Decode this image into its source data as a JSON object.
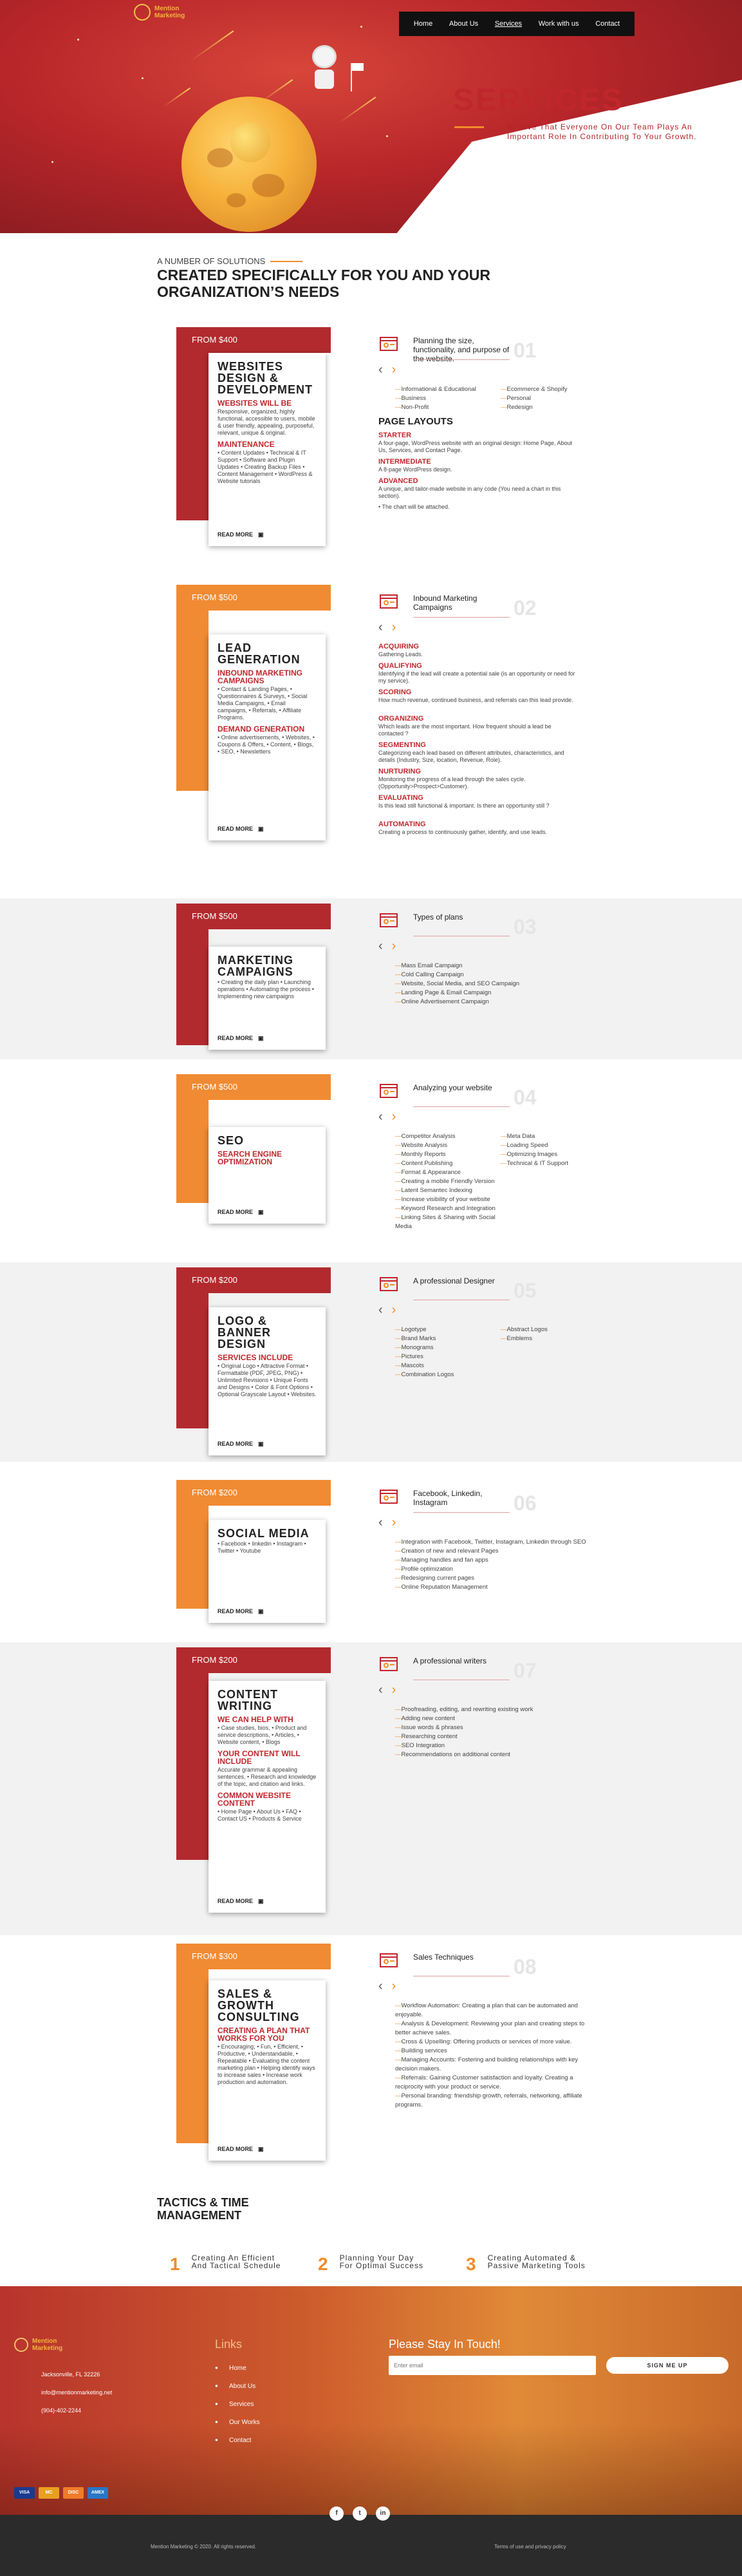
{
  "brand": {
    "name_line1": "Mention",
    "name_line2": "Marketing"
  },
  "nav": [
    "Home",
    "About Us",
    "Services",
    "Work with us",
    "Contact"
  ],
  "hero": {
    "title": "SERVICES",
    "subtitle": "Believe That Everyone On Our Team Plays An Important Role In Contributing To Your Growth."
  },
  "intro": {
    "small": "A NUMBER OF SOLUTIONS",
    "big": "CREATED SPECIFICALLY FOR YOU AND YOUR ORGANIZATION’S NEEDS"
  },
  "read_more": "READ MORE",
  "services": [
    {
      "price": "FROM $400",
      "block_color": "red",
      "title": "WEBSITES DESIGN & DEVELOPMENT",
      "subs": [
        {
          "h": "WEBSITES WILL BE",
          "p": "Responsive, organized, highly functional, accessible to users, mobile & user friendly, appealing, purposeful, relevant, unique & original."
        },
        {
          "h": "MAINTENANCE",
          "p": "• Content Updates • Technical & IT Support • Software and Plugin Updates • Creating Backup Files • Content Management • WordPress & Website tutorials"
        }
      ],
      "num": "01",
      "heading": "Planning the size, functionality, and purpose of the website.",
      "list_cols": [
        [
          "Informational & Educational",
          "Business",
          "Non-Profit"
        ],
        [
          "Ecommerce & Shopify",
          "Personal",
          "Redesign"
        ]
      ],
      "extra_title": "PAGE LAYOUTS",
      "details": [
        {
          "h": "STARTER",
          "p": "A four-page, WordPress website with an original design: Home Page, About Us, Services, and Contact Page."
        },
        {
          "h": "INTERMEDIATE",
          "p": "A 8-page WordPress design."
        },
        {
          "h": "ADVANCED",
          "p": "A unique, and tailor-made website in any code (You need a chart in this section)."
        },
        {
          "h": "",
          "p": "• The chart will be attached."
        }
      ]
    },
    {
      "price": "FROM $500",
      "block_color": "orange",
      "title": "LEAD GENERATION",
      "subs": [
        {
          "h": "INBOUND MARKETING CAMPAIGNS",
          "p": "• Contact & Landing Pages, • Questionnaires & Surveys, • Social Media Campaigns, • Email campaigns, • Referrals, • Affiliate Programs."
        },
        {
          "h": "DEMAND GENERATION",
          "p": "• Online advertisements, • Websites, • Coupons & Offers, • Content, • Blogs, • SEO, • Newsletters"
        }
      ],
      "num": "02",
      "heading": "Inbound Marketing Campaigns",
      "list_cols": [],
      "extra_title": "",
      "details": [
        {
          "h": "ACQUIRING",
          "p": "Gathering Leads."
        },
        {
          "h": "QUALIFYING",
          "p": "Identifying if the lead will create a potential sale (is an opportunity or need for my service)."
        },
        {
          "h": "SCORING",
          "p": "How much revenue, continued business, and referrals can this lead provide."
        },
        {
          "h": "ORGANIZING",
          "p": "Which leads are the most important. How frequent should a lead be contacted ?"
        },
        {
          "h": "SEGMENTING",
          "p": "Categorizing each lead based on different attributes, characteristics, and details (Industry, Size, location, Revenue, Role)."
        },
        {
          "h": "NURTURING",
          "p": "Monitoring the progress of a lead through the sales cycle. (Opportunity>Prospect>Customer)."
        },
        {
          "h": "EVALUATING",
          "p": "Is this lead still functional & important. Is there an opportunity still ?"
        },
        {
          "h": "AUTOMATING",
          "p": "Creating a process to continuously gather, identify, and use leads."
        }
      ]
    },
    {
      "price": "FROM $500",
      "block_color": "red",
      "title": "MARKETING CAMPAIGNS",
      "subs": [
        {
          "h": "",
          "p": "• Creating the daily plan • Launching operations • Automating the process • Implementing new campaigns"
        }
      ],
      "num": "03",
      "heading": "Types of plans",
      "list_cols": [
        [
          "Mass Email Campaign",
          "Cold Calling Campaign",
          "Website, Social Media, and SEO Campaign",
          "Landing Page & Email Campaign",
          "Online Advertisement Campaign"
        ]
      ],
      "extra_title": "",
      "details": []
    },
    {
      "price": "FROM $500",
      "block_color": "orange",
      "title": "SEO",
      "subs": [
        {
          "h": "SEARCH ENGINE OPTIMIZATION",
          "p": ""
        }
      ],
      "num": "04",
      "heading": "Analyzing your website",
      "list_cols": [
        [
          "Competitor Analysis",
          "Website Analysis",
          "Monthly Reports",
          "Content Publishing",
          "Format & Appearance",
          "Creating a mobile Friendly Version",
          "Latent Semantec Indexing",
          "Increase visibility of your website",
          "Keyword Research and Integration",
          "Linking Sites & Sharing with Social Media"
        ],
        [
          "Meta Data",
          "Loading Speed",
          "Optimizing Images",
          "Technical & IT Support"
        ]
      ],
      "extra_title": "",
      "details": []
    },
    {
      "price": "FROM $200",
      "block_color": "red",
      "title": "LOGO & BANNER DESIGN",
      "subs": [
        {
          "h": "SERVICES INCLUDE",
          "p": "• Original Logo • Attractive Format • Formattable (PDF, JPEG, PNG) • Unlimited Revisions • Unique Fonts and Designs • Color & Font Options • Optional Grayscale Layout • Websites."
        }
      ],
      "num": "05",
      "heading": "A professional Designer",
      "list_cols": [
        [
          "Logotype",
          "Brand Marks",
          "Monograms",
          "Pictures",
          "Mascots",
          "Combination Logos"
        ],
        [
          "Abstract Logos",
          "Emblems"
        ]
      ],
      "extra_title": "",
      "details": []
    },
    {
      "price": "FROM $200",
      "block_color": "orange",
      "title": "SOCIAL MEDIA",
      "subs": [
        {
          "h": "",
          "p": "• Facebook • linkedin • Instagram • Twitter • Youtube"
        }
      ],
      "num": "06",
      "heading": "Facebook, Linkedin, Instagram",
      "list_cols": [
        [
          "Integration with Facebook, Twitter, Instagram, Linkedin through SEO",
          "Creation of new and relevant Pages",
          "Managing handles and fan apps",
          "Profile optimization",
          "Redesigning current pages",
          "Online Reputation Management"
        ]
      ],
      "extra_title": "",
      "details": []
    },
    {
      "price": "FROM $200",
      "block_color": "red",
      "title": "CONTENT WRITING",
      "subs": [
        {
          "h": "WE CAN HELP WITH",
          "p": "• Case studies, bios, • Product and service descriptions, • Articles, • Website content, • Blogs"
        },
        {
          "h": "YOUR CONTENT WILL INCLUDE",
          "p": "Accurate grammar & appealing sentences. • Research and knowledge of the topic, and citation and links."
        },
        {
          "h": "COMMON WEBSITE CONTENT",
          "p": "• Home Page • About Us • FAQ • Contact US • Products & Service"
        }
      ],
      "num": "07",
      "heading": "A professional writers",
      "list_cols": [
        [
          "Proofreading, editing, and rewriting existing work",
          "Adding new content",
          "Issue words & phrases",
          "Researching content",
          "SEO Integration",
          "Recommendations on additional content"
        ]
      ],
      "extra_title": "",
      "details": []
    },
    {
      "price": "FROM $300",
      "block_color": "orange",
      "title": "SALES & GROWTH CONSULTING",
      "subs": [
        {
          "h": "CREATING A PLAN THAT WORKS FOR YOU",
          "p": "• Encouraging, • Fun, • Efficient, • Productive, • Understandable, • Repeatable • Evaluating the content marketing plan • Helping identify ways to increase sales • Increase work production and automation."
        }
      ],
      "num": "08",
      "heading": "Sales Techniques",
      "list_cols": [
        [
          "Workflow Automation: Creating a plan that can be automated and enjoyable.",
          "Analysis & Development: Reviewing your plan and creating steps to better achieve sales.",
          "Cross & Upselling: Offering products or services of more value.",
          "Building services",
          "Managing Accounts: Fostering and building relationships with key decision makers.",
          "Referrals: Gaining Customer satisfaction and loyalty. Creating a reciprocity with your product or service.",
          "Personal branding: friendship growth, referrals, networking, affiliate programs."
        ]
      ],
      "extra_title": "",
      "details": []
    }
  ],
  "tactics": {
    "title": "TACTICS & TIME MANAGEMENT",
    "items": [
      {
        "num": "1",
        "text": "Creating An Efficient And Tactical Schedule"
      },
      {
        "num": "2",
        "text": "Planning Your Day For Optimal Success"
      },
      {
        "num": "3",
        "text": "Creating Automated & Passive Marketing Tools"
      }
    ]
  },
  "footer": {
    "address": "Jacksonville, FL 32226",
    "email": "info@mentionmarketing.net",
    "phone": "(904)-402-2244",
    "links_title": "Links",
    "links": [
      "Home",
      "About Us",
      "Services",
      "Our Works",
      "Contact"
    ],
    "touch_title": "Please Stay In Touch!",
    "email_placeholder": "Enter email",
    "signup": "SIGN ME UP",
    "payments": [
      "VISA",
      "MC",
      "DISC",
      "AMEX"
    ],
    "social": [
      "f",
      "t",
      "in"
    ],
    "copyright": "Mention Marketing © 2020. All rights reserved.",
    "terms": "Terms of use and privacy policy"
  },
  "colors": {
    "red": "#c0272d",
    "orange": "#f18c2a",
    "dark": "#2b2b2b"
  }
}
